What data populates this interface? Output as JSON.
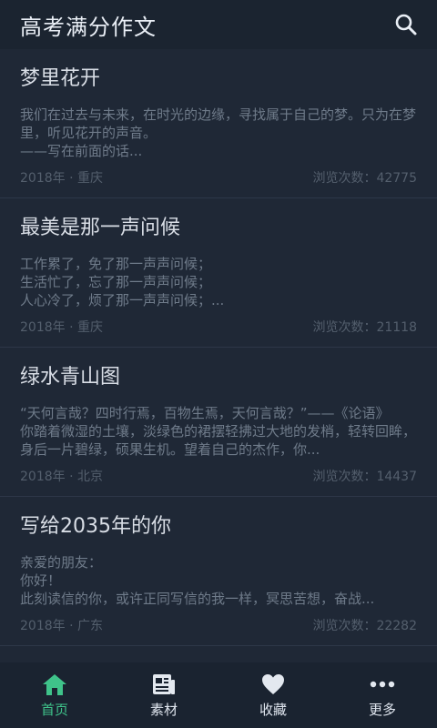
{
  "header": {
    "title": "高考满分作文"
  },
  "articles": [
    {
      "title": "梦里花开",
      "excerpt": "我们在过去与未来，在时光的边缘，寻找属于自己的梦。只为在梦里，听见花开的声音。\n——写在前面的话...",
      "meta_left": "2018年 · 重庆",
      "meta_right": "浏览次数：42775"
    },
    {
      "title": "最美是那一声问候",
      "excerpt": "工作累了，免了那一声声问候；\n生活忙了，忘了那一声声问候；\n人心冷了，烦了那一声声问候；...",
      "meta_left": "2018年 · 重庆",
      "meta_right": "浏览次数：21118"
    },
    {
      "title": "绿水青山图",
      "excerpt": "“天何言哉？四时行焉，百物生焉，天何言哉？”——《论语》\n你踏着微湿的土壤，淡绿色的裙摆轻拂过大地的发梢，轻转回眸，身后一片碧绿，硕果生机。望着自己的杰作，你...",
      "meta_left": "2018年 · 北京",
      "meta_right": "浏览次数：14437"
    },
    {
      "title": "写给2035年的你",
      "excerpt": "亲爱的朋友：\n 你好！\n 此刻读信的你，或许正同写信的我一样，冥思苦想，奋战...",
      "meta_left": "2018年 · 广东",
      "meta_right": "浏览次数：22282"
    }
  ],
  "partial_title": "...",
  "tabs": [
    {
      "label": "首页",
      "icon": "home-icon"
    },
    {
      "label": "素材",
      "icon": "news-icon"
    },
    {
      "label": "收藏",
      "icon": "heart-icon"
    },
    {
      "label": "更多",
      "icon": "more-icon"
    }
  ],
  "colors": {
    "accent": "#3fc38a",
    "background": "#1e2735"
  }
}
